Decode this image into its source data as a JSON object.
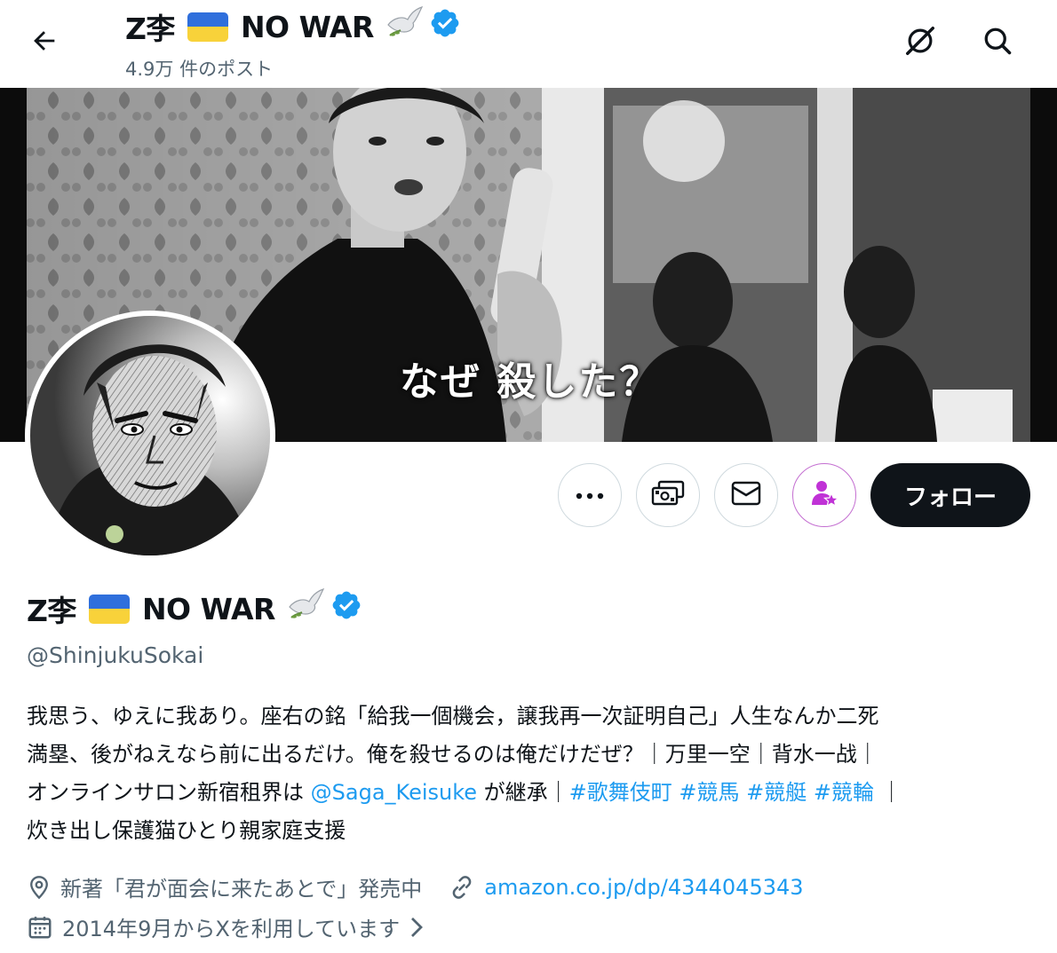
{
  "header": {
    "name_prefix": "Z李",
    "name_suffix": "NO WAR",
    "post_count": "4.9万 件のポスト"
  },
  "banner": {
    "caption": "なぜ 殺した？"
  },
  "actions": {
    "follow_label": "フォロー"
  },
  "profile": {
    "name_prefix": "Z李",
    "name_suffix": "NO WAR",
    "handle": "@ShinjukuSokai",
    "bio": {
      "line1": "我思う、ゆえに我あり。座右の銘「給我一個機会，譲我再一次証明自己」人生なんか二死",
      "line2": "満塁、後がねえなら前に出るだけ。俺を殺せるのは俺だけだぜ？｜万里一空｜背水一战｜",
      "line3_pre": "オンラインサロン新宿租界は ",
      "mention": "@Saga_Keisuke",
      "line3_mid": " が継承｜",
      "hashtags": [
        "#歌舞伎町",
        "#競馬",
        "#競艇",
        "#競輪"
      ],
      "line3_end": " ｜",
      "line4": "炊き出し保護猫ひとり親家庭支援"
    },
    "location": "新著「君が面会に来たあとで」発売中",
    "website": "amazon.co.jp/dp/4344045343",
    "joined": "2014年9月からXを利用しています"
  },
  "icons": [
    "back-arrow-icon",
    "grok-icon",
    "search-icon",
    "more-icon",
    "tip-jar-icon",
    "message-icon",
    "subscribe-icon",
    "location-icon",
    "link-icon",
    "calendar-icon",
    "chevron-right-icon",
    "verified-badge-icon",
    "dove-icon",
    "ukraine-flag-icon"
  ],
  "colors": {
    "accent": "#1d9bf0",
    "text": "#0f1419",
    "secondary": "#536471",
    "flag_blue": "#2f6fdc",
    "flag_yellow": "#f8d23a",
    "subscribe_purple": "#c46fd1"
  }
}
